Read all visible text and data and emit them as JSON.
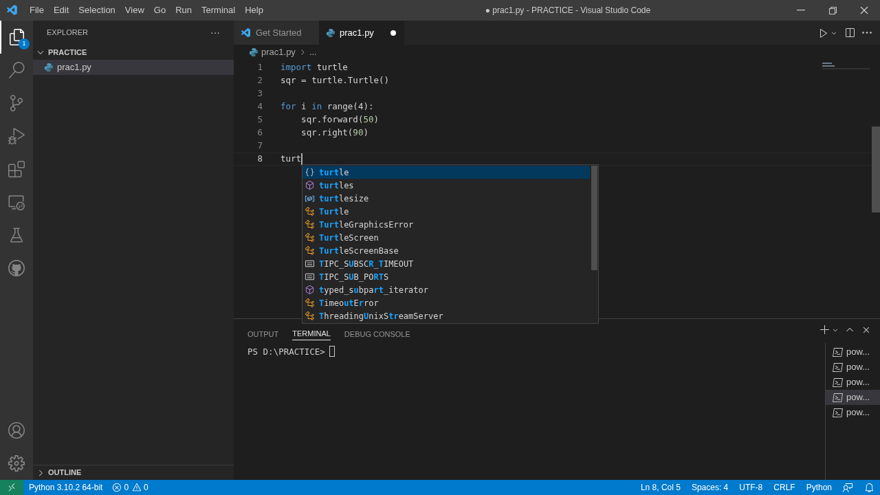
{
  "window": {
    "title": "● prac1.py - PRACTICE - Visual Studio Code"
  },
  "menu": [
    "File",
    "Edit",
    "Selection",
    "View",
    "Go",
    "Run",
    "Terminal",
    "Help"
  ],
  "activity_bar": {
    "explorer_badge": "1"
  },
  "sidebar": {
    "title": "EXPLORER",
    "more": "···",
    "folder": {
      "name": "PRACTICE",
      "expanded": true,
      "children": [
        {
          "name": "prac1.py",
          "selected": true
        }
      ]
    },
    "outline": {
      "name": "OUTLINE",
      "expanded": false
    }
  },
  "tabs": [
    {
      "label": "Get Started",
      "kind": "welcome",
      "selected": false,
      "modified": false
    },
    {
      "label": "prac1.py",
      "kind": "python",
      "selected": true,
      "modified": true
    }
  ],
  "breadcrumb": {
    "file": "prac1.py",
    "rest": "..."
  },
  "code": [
    {
      "number": "1",
      "current": false,
      "tokens": [
        {
          "text": "import",
          "kind": "keyword"
        },
        {
          "text": " turtle",
          "kind": "plain"
        }
      ]
    },
    {
      "number": "2",
      "current": false,
      "tokens": [
        {
          "text": "sqr = turtle.Turtle()",
          "kind": "plain"
        }
      ]
    },
    {
      "number": "3",
      "current": false
    },
    {
      "number": "4",
      "current": false,
      "tokens": [
        {
          "text": "for",
          "kind": "keyword"
        },
        {
          "text": " i ",
          "kind": "plain"
        },
        {
          "text": "in",
          "kind": "keyword"
        },
        {
          "text": " range(4):",
          "kind": "plain"
        }
      ]
    },
    {
      "number": "5",
      "current": false,
      "tokens": [
        {
          "text": "    sqr.forward(",
          "kind": "plain"
        },
        {
          "text": "50",
          "kind": "number"
        },
        {
          "text": ")",
          "kind": "plain"
        }
      ]
    },
    {
      "number": "6",
      "current": false,
      "tokens": [
        {
          "text": "    sqr.right(",
          "kind": "plain"
        },
        {
          "text": "90",
          "kind": "number"
        },
        {
          "text": ")",
          "kind": "plain"
        }
      ]
    },
    {
      "number": "7",
      "current": false
    },
    {
      "number": "8",
      "current": true,
      "tokens": [
        {
          "text": "turt",
          "kind": "plain"
        }
      ]
    }
  ],
  "suggestions": [
    {
      "kind": "module",
      "selected": true,
      "parts": [
        {
          "text": "turt",
          "match": true
        },
        {
          "text": "le",
          "match": false
        }
      ]
    },
    {
      "kind": "function",
      "selected": false,
      "parts": [
        {
          "text": "turt",
          "match": true
        },
        {
          "text": "les",
          "match": false
        }
      ]
    },
    {
      "kind": "variable",
      "selected": false,
      "parts": [
        {
          "text": "turt",
          "match": true
        },
        {
          "text": "lesize",
          "match": false
        }
      ]
    },
    {
      "kind": "class",
      "selected": false,
      "parts": [
        {
          "text": "Turt",
          "match": true
        },
        {
          "text": "le",
          "match": false
        }
      ]
    },
    {
      "kind": "class",
      "selected": false,
      "parts": [
        {
          "text": "Turt",
          "match": true
        },
        {
          "text": "leGraphicsError",
          "match": false
        }
      ]
    },
    {
      "kind": "class",
      "selected": false,
      "parts": [
        {
          "text": "Turt",
          "match": true
        },
        {
          "text": "leScreen",
          "match": false
        }
      ]
    },
    {
      "kind": "class",
      "selected": false,
      "parts": [
        {
          "text": "Turt",
          "match": true
        },
        {
          "text": "leScreenBase",
          "match": false
        }
      ]
    },
    {
      "kind": "constant",
      "selected": false,
      "parts": [
        {
          "text": "T",
          "match": true
        },
        {
          "text": "IPC_S",
          "match": false
        },
        {
          "text": "U",
          "match": true
        },
        {
          "text": "BSC",
          "match": false
        },
        {
          "text": "R",
          "match": true
        },
        {
          "text": "_",
          "match": false
        },
        {
          "text": "T",
          "match": true
        },
        {
          "text": "IMEOUT",
          "match": false
        }
      ]
    },
    {
      "kind": "constant",
      "selected": false,
      "parts": [
        {
          "text": "T",
          "match": true
        },
        {
          "text": "IPC_S",
          "match": false
        },
        {
          "text": "U",
          "match": true
        },
        {
          "text": "B_PO",
          "match": false
        },
        {
          "text": "R",
          "match": true
        },
        {
          "text": "T",
          "match": true
        },
        {
          "text": "S",
          "match": false
        }
      ]
    },
    {
      "kind": "function",
      "selected": false,
      "parts": [
        {
          "text": "t",
          "match": true
        },
        {
          "text": "yped_s",
          "match": false
        },
        {
          "text": "u",
          "match": true
        },
        {
          "text": "bpa",
          "match": false
        },
        {
          "text": "r",
          "match": true
        },
        {
          "text": "t",
          "match": true
        },
        {
          "text": "_iterator",
          "match": false
        }
      ]
    },
    {
      "kind": "class",
      "selected": false,
      "parts": [
        {
          "text": "T",
          "match": true
        },
        {
          "text": "imeo",
          "match": false
        },
        {
          "text": "ut",
          "match": true
        },
        {
          "text": "E",
          "match": false
        },
        {
          "text": "r",
          "match": true
        },
        {
          "text": "ror",
          "match": false
        }
      ]
    },
    {
      "kind": "class",
      "selected": false,
      "parts": [
        {
          "text": "T",
          "match": true
        },
        {
          "text": "hreading",
          "match": false
        },
        {
          "text": "U",
          "match": true
        },
        {
          "text": "nixS",
          "match": false
        },
        {
          "text": "tr",
          "match": true
        },
        {
          "text": "eamServer",
          "match": false
        }
      ]
    }
  ],
  "panel": {
    "tabs": [
      {
        "label": "OUTPUT",
        "selected": false
      },
      {
        "label": "TERMINAL",
        "selected": true
      },
      {
        "label": "DEBUG CONSOLE",
        "selected": false
      }
    ],
    "prompt": "PS D:\\PRACTICE>",
    "terminals": [
      {
        "label": "pow...",
        "selected": false
      },
      {
        "label": "pow...",
        "selected": false
      },
      {
        "label": "pow...",
        "selected": false
      },
      {
        "label": "pow...",
        "selected": true
      },
      {
        "label": "pow...",
        "selected": false
      }
    ]
  },
  "status_bar": {
    "interpreter": "Python 3.10.2 64-bit",
    "errors": "0",
    "warnings": "0",
    "position": "Ln 8, Col 5",
    "spaces": "Spaces: 4",
    "encoding": "UTF-8",
    "eol": "CRLF",
    "language": "Python"
  }
}
